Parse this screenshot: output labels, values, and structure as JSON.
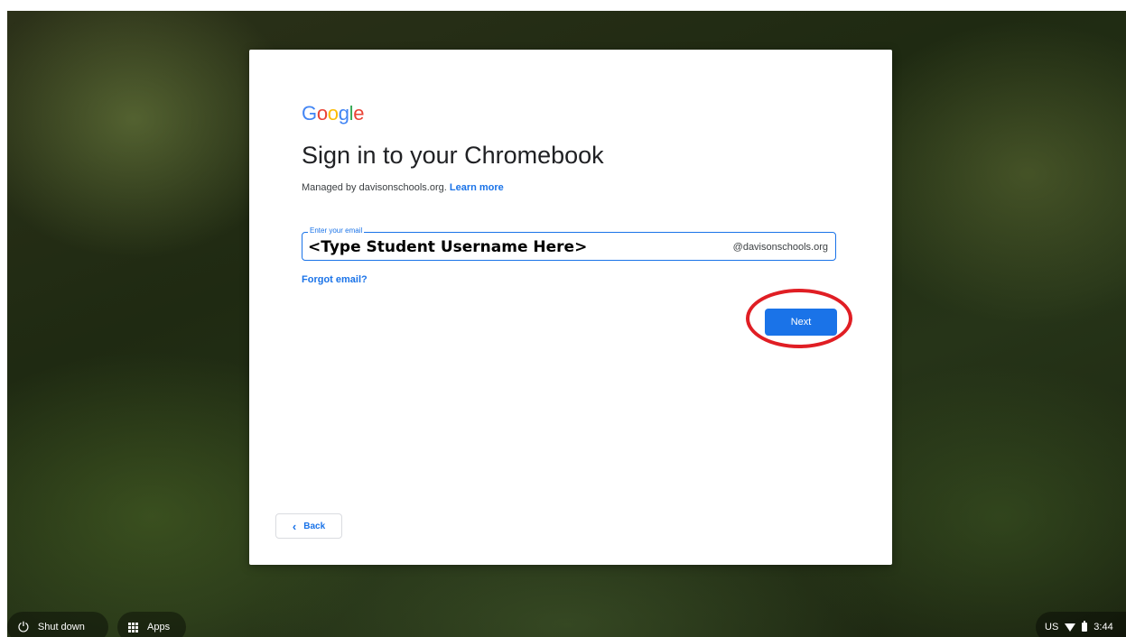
{
  "colors": {
    "accent": "#1a73e8",
    "highlight_ring": "#e01e24",
    "google_blue": "#4285f4",
    "google_red": "#ea4335",
    "google_yellow": "#fbbc05",
    "google_green": "#34a853"
  },
  "dialog": {
    "logo_letters": [
      "G",
      "o",
      "o",
      "g",
      "l",
      "e"
    ],
    "title": "Sign in to your Chromebook",
    "managed_prefix": "Managed by davisonschools.org.",
    "learn_more": "Learn more",
    "email": {
      "label": "Enter your email",
      "value": "<Type Student Username Here>",
      "suffix": "@davisonschools.org"
    },
    "forgot_email": "Forgot email?",
    "next_button": "Next",
    "back_button": "Back",
    "back_icon": "chevron-left-icon"
  },
  "shelf": {
    "shutdown_label": "Shut down",
    "shutdown_icon": "power-icon",
    "apps_label": "Apps",
    "apps_icon": "apps-grid-icon"
  },
  "tray": {
    "language": "US",
    "wifi_icon": "wifi-icon",
    "battery_icon": "battery-icon",
    "time": "3:44"
  }
}
